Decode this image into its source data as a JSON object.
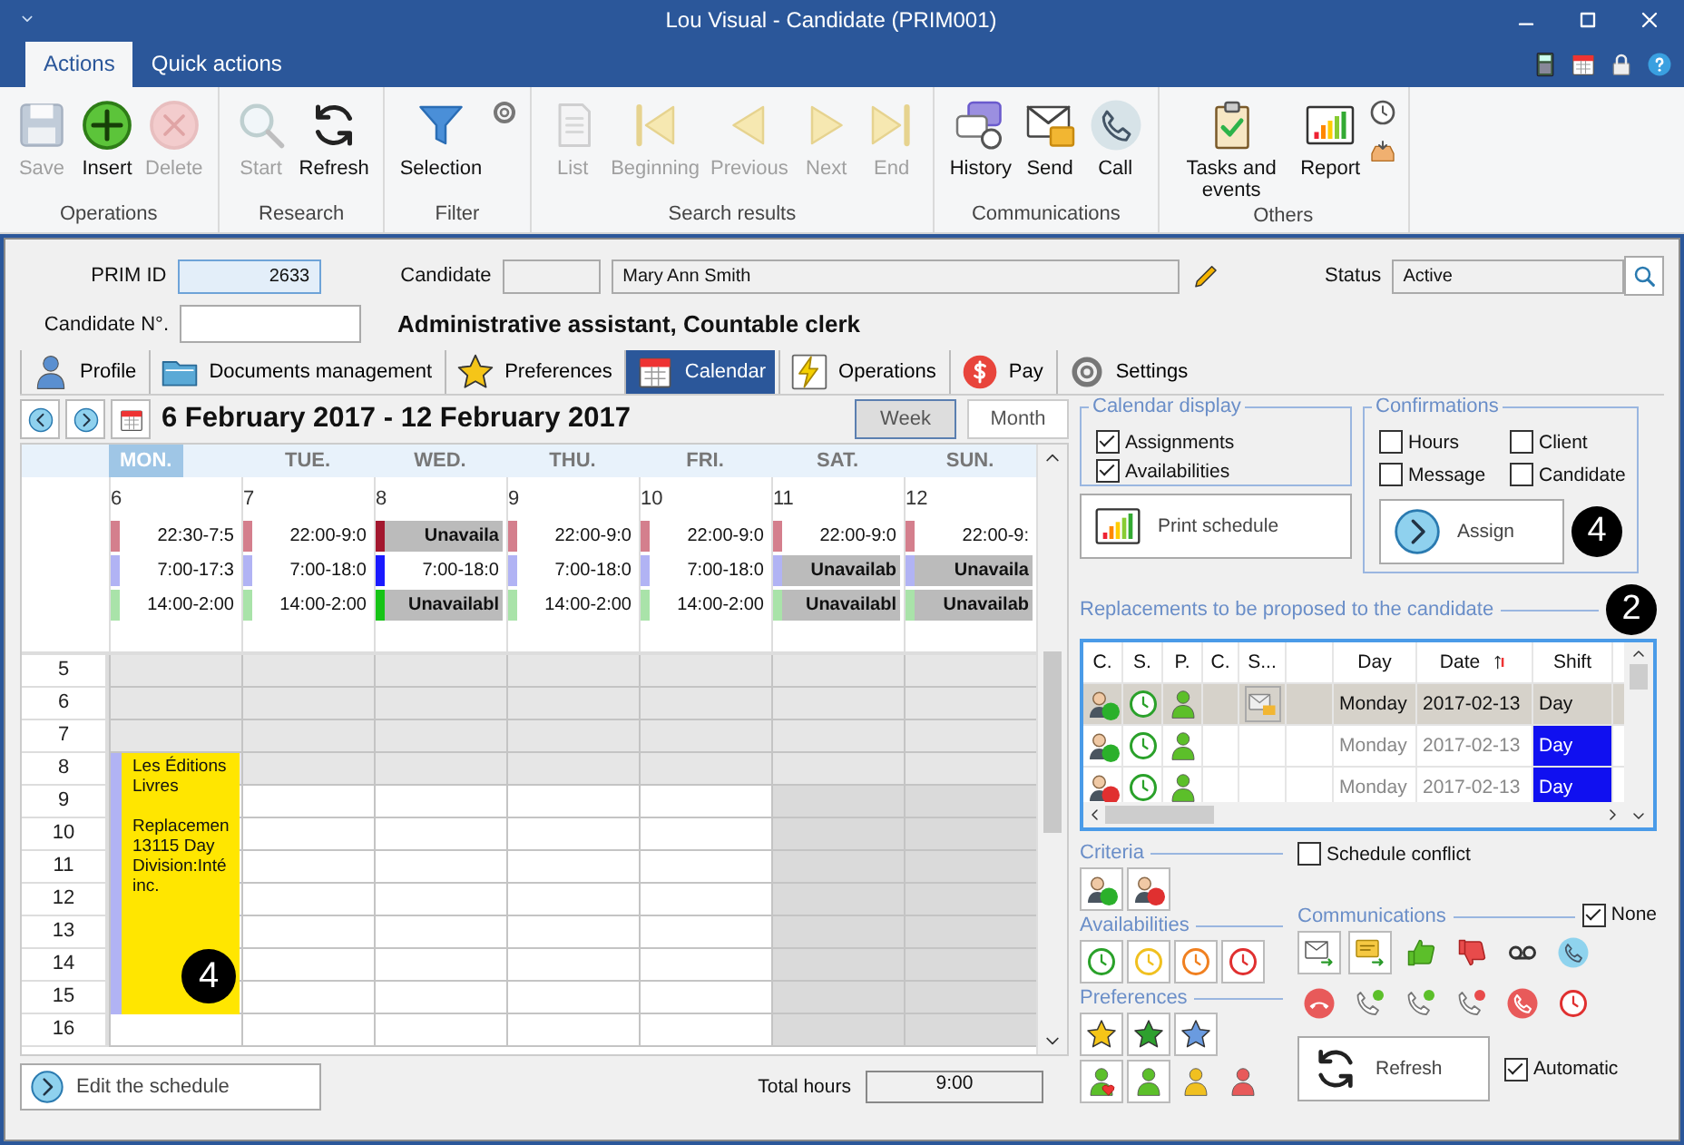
{
  "window": {
    "title": "Lou Visual - Candidate (PRIM001)"
  },
  "ribbon_tabs": [
    {
      "label": "Actions",
      "selected": true
    },
    {
      "label": "Quick actions",
      "selected": false
    }
  ],
  "ribbon_groups": [
    {
      "label": "Operations",
      "buttons": [
        {
          "label": "Save",
          "kind": "save",
          "disabled": true
        },
        {
          "label": "Insert",
          "kind": "plus",
          "disabled": false
        },
        {
          "label": "Delete",
          "kind": "xcircle",
          "disabled": true
        }
      ]
    },
    {
      "label": "Research",
      "buttons": [
        {
          "label": "Start",
          "kind": "search",
          "disabled": true
        },
        {
          "label": "Refresh",
          "kind": "refresh",
          "disabled": false
        }
      ]
    },
    {
      "label": "Filter",
      "buttons": [
        {
          "label": "Selection",
          "kind": "filter",
          "disabled": false
        }
      ],
      "extras": [
        {
          "kind": "gear"
        }
      ]
    },
    {
      "label": "Search results",
      "buttons": [
        {
          "label": "List",
          "kind": "doc",
          "disabled": true
        },
        {
          "label": "Beginning",
          "kind": "first",
          "disabled": true
        },
        {
          "label": "Previous",
          "kind": "prev",
          "disabled": true
        },
        {
          "label": "Next",
          "kind": "next",
          "disabled": true
        },
        {
          "label": "End",
          "kind": "last",
          "disabled": true
        }
      ]
    },
    {
      "label": "Communications",
      "buttons": [
        {
          "label": "History",
          "kind": "chat",
          "disabled": false
        },
        {
          "label": "Send",
          "kind": "mail",
          "disabled": false
        },
        {
          "label": "Call",
          "kind": "phone",
          "disabled": false
        }
      ]
    },
    {
      "label": "Others",
      "buttons": [
        {
          "label": "Tasks and events",
          "kind": "clipboard",
          "disabled": false
        },
        {
          "label": "Report",
          "kind": "chart",
          "disabled": false
        }
      ],
      "extras": [
        {
          "kind": "clock"
        },
        {
          "kind": "tray"
        }
      ]
    }
  ],
  "form": {
    "prim_id": {
      "label": "PRIM ID",
      "value": "2633"
    },
    "candidate": {
      "label": "Candidate",
      "name": "Mary Ann Smith"
    },
    "status": {
      "label": "Status",
      "value": "Active"
    },
    "candidate_no": {
      "label": "Candidate N°."
    },
    "job_title": "Administrative assistant, Countable clerk"
  },
  "tabs": [
    {
      "label": "Profile",
      "kind": "person",
      "selected": false
    },
    {
      "label": "Documents management",
      "kind": "folder",
      "selected": false
    },
    {
      "label": "Preferences",
      "kind": "star",
      "selected": false
    },
    {
      "label": "Calendar",
      "kind": "cal",
      "selected": true
    },
    {
      "label": "Operations",
      "kind": "flash",
      "selected": false
    },
    {
      "label": "Pay",
      "kind": "dollar",
      "selected": false
    },
    {
      "label": "Settings",
      "kind": "gear",
      "selected": false
    }
  ],
  "calendar": {
    "range": "6 February 2017 - 12 February 2017",
    "views": [
      {
        "label": "Week",
        "selected": true
      },
      {
        "label": "Month",
        "selected": false
      }
    ],
    "days": [
      {
        "name": "MON.",
        "date": "6",
        "selected": true,
        "weekend": false,
        "entries": [
          {
            "kind": "time",
            "text": "22:30-7:5",
            "color": "#d47f8d"
          },
          {
            "kind": "time",
            "text": "7:00-17:3",
            "color": "#b1b3f4"
          },
          {
            "kind": "time",
            "text": "14:00-2:00",
            "color": "#a9e3a9"
          }
        ],
        "event": {
          "title": "Les Éditions\nLivres",
          "details": "Replacemen\n13115 Day\nDivision:Inté\ninc.",
          "color": "#b1b3f4",
          "callout": "4"
        }
      },
      {
        "name": "TUE.",
        "date": "7",
        "selected": false,
        "weekend": false,
        "entries": [
          {
            "kind": "time",
            "text": "22:00-9:0",
            "color": "#d47f8d"
          },
          {
            "kind": "time",
            "text": "7:00-18:0",
            "color": "#b1b3f4"
          },
          {
            "kind": "time",
            "text": "14:00-2:00",
            "color": "#a9e3a9"
          }
        ]
      },
      {
        "name": "WED.",
        "date": "8",
        "selected": false,
        "weekend": false,
        "entries": [
          {
            "kind": "unavailable",
            "text": "Unavaila",
            "color": "#a3182f"
          },
          {
            "kind": "time",
            "text": "7:00-18:0",
            "color": "#1a1aff"
          },
          {
            "kind": "unavailable",
            "text": "Unavailabl",
            "color": "#16c416"
          }
        ]
      },
      {
        "name": "THU.",
        "date": "9",
        "selected": false,
        "weekend": false,
        "entries": [
          {
            "kind": "time",
            "text": "22:00-9:0",
            "color": "#d47f8d"
          },
          {
            "kind": "time",
            "text": "7:00-18:0",
            "color": "#b1b3f4"
          },
          {
            "kind": "time",
            "text": "14:00-2:00",
            "color": "#a9e3a9"
          }
        ]
      },
      {
        "name": "FRI.",
        "date": "10",
        "selected": false,
        "weekend": false,
        "entries": [
          {
            "kind": "time",
            "text": "22:00-9:0",
            "color": "#d47f8d"
          },
          {
            "kind": "time",
            "text": "7:00-18:0",
            "color": "#b1b3f4"
          },
          {
            "kind": "time",
            "text": "14:00-2:00",
            "color": "#a9e3a9"
          }
        ]
      },
      {
        "name": "SAT.",
        "date": "11",
        "selected": false,
        "weekend": true,
        "entries": [
          {
            "kind": "time",
            "text": "22:00-9:0",
            "color": "#d47f8d"
          },
          {
            "kind": "unavailable",
            "text": "Unavailab",
            "color": "#b1b3f4"
          },
          {
            "kind": "unavailable",
            "text": "Unavailabl",
            "color": "#a9e3a9"
          }
        ]
      },
      {
        "name": "SUN.",
        "date": "12",
        "selected": false,
        "weekend": true,
        "entries": [
          {
            "kind": "time",
            "text": "22:00-9:",
            "color": "#d47f8d"
          },
          {
            "kind": "unavailable",
            "text": "Unavaila",
            "color": "#b1b3f4"
          },
          {
            "kind": "unavailable",
            "text": "Unavailab",
            "color": "#a9e3a9"
          }
        ]
      }
    ],
    "hours": [
      {
        "label": "5",
        "off_hours": true
      },
      {
        "label": "6",
        "off_hours": true
      },
      {
        "label": "7",
        "off_hours": true
      },
      {
        "label": "8",
        "off_hours": true
      },
      {
        "label": "9",
        "off_hours": false
      },
      {
        "label": "10",
        "off_hours": false
      },
      {
        "label": "11",
        "off_hours": false
      },
      {
        "label": "12",
        "off_hours": false
      },
      {
        "label": "13",
        "off_hours": false
      },
      {
        "label": "14",
        "off_hours": false
      },
      {
        "label": "15",
        "off_hours": false
      },
      {
        "label": "16",
        "off_hours": false
      }
    ],
    "edit_button": "Edit the schedule",
    "total_hours": {
      "label": "Total hours",
      "value": "9:00"
    }
  },
  "calendar_display": {
    "title": "Calendar display",
    "options": [
      {
        "label": "Assignments",
        "checked": true
      },
      {
        "label": "Availabilities",
        "checked": true
      }
    ],
    "print_button": "Print schedule"
  },
  "confirmations": {
    "title": "Confirmations",
    "options": [
      {
        "label": "Hours",
        "checked": false
      },
      {
        "label": "Client",
        "checked": false
      },
      {
        "label": "Message",
        "checked": false
      },
      {
        "label": "Candidate",
        "checked": false
      }
    ],
    "assign_button": "Assign",
    "callout": "4"
  },
  "replacements": {
    "title": "Replacements to be proposed to the candidate",
    "callout": "2",
    "columns": [
      {
        "kind": "text",
        "label": "C."
      },
      {
        "kind": "text",
        "label": "S."
      },
      {
        "kind": "text",
        "label": "P."
      },
      {
        "kind": "text",
        "label": "C."
      },
      {
        "kind": "text",
        "label": "S..."
      },
      {
        "kind": "blank"
      },
      {
        "kind": "text",
        "label": "Day"
      },
      {
        "kind": "text",
        "label": "Date",
        "sorted": true
      },
      {
        "kind": "text",
        "label": "Shift"
      }
    ],
    "rows": [
      {
        "selected": true,
        "color": "#2bb02b",
        "message": true,
        "day": "Monday",
        "date": "2017-02-13",
        "shift": "Day"
      },
      {
        "selected": false,
        "color": "#2bb02b",
        "message": false,
        "day": "Monday",
        "date": "2017-02-13",
        "shift": "Day"
      },
      {
        "selected": false,
        "color": "#e03030",
        "message": false,
        "day": "Monday",
        "date": "2017-02-13",
        "shift": "Day"
      }
    ]
  },
  "criteria": {
    "title": "Criteria",
    "items": [
      {
        "color": "#2bb02b",
        "selected": true
      },
      {
        "color": "#e03030",
        "selected": true
      }
    ]
  },
  "schedule_conflict": {
    "label": "Schedule conflict",
    "checked": false
  },
  "availabilities": {
    "title": "Availabilities",
    "items": [
      {
        "color": "#2aa12a",
        "selected": true
      },
      {
        "color": "#f0c020",
        "selected": true
      },
      {
        "color": "#f08020",
        "selected": true
      },
      {
        "color": "#e03030",
        "selected": true
      }
    ]
  },
  "communications": {
    "title": "Communications",
    "none": {
      "label": "None",
      "checked": true
    },
    "items": [
      {
        "kind": "mail_send",
        "selected": true
      },
      {
        "kind": "sms_send",
        "selected": true
      },
      {
        "kind": "thumb_up",
        "selected": false
      },
      {
        "kind": "thumb_down",
        "selected": false
      },
      {
        "kind": "voicemail",
        "selected": false
      },
      {
        "kind": "phone",
        "color": "#8fd3ee",
        "selected": false
      },
      {
        "kind": "hang_up",
        "color": "#e85a5a",
        "selected": false
      },
      {
        "kind": "phone_status",
        "color": "#5cbf2a",
        "selected": false
      },
      {
        "kind": "phone_status",
        "color": "#5cbf2a",
        "selected": false
      },
      {
        "kind": "phone_status",
        "color": "#e84b4b",
        "selected": false
      },
      {
        "kind": "phone_missed",
        "color": "#e85a5a",
        "selected": false
      },
      {
        "kind": "clock",
        "color": "#e03030",
        "selected": false
      }
    ]
  },
  "preferences": {
    "title": "Preferences",
    "items": [
      {
        "kind": "star",
        "color": "#f5c518",
        "selected": true
      },
      {
        "kind": "star",
        "color": "#2ea02e",
        "selected": true
      },
      {
        "kind": "star",
        "color": "#6a9be0",
        "selected": true
      },
      {
        "kind": "person_heart",
        "color": "#5cbf2a",
        "selected": true
      },
      {
        "kind": "person",
        "color": "#5cbf2a",
        "selected": true
      },
      {
        "kind": "person",
        "color": "#f0c020",
        "selected": false
      },
      {
        "kind": "person",
        "color": "#e85a5a",
        "selected": false
      }
    ]
  },
  "refresh_button": "Refresh",
  "automatic": {
    "label": "Automatic",
    "checked": true
  }
}
